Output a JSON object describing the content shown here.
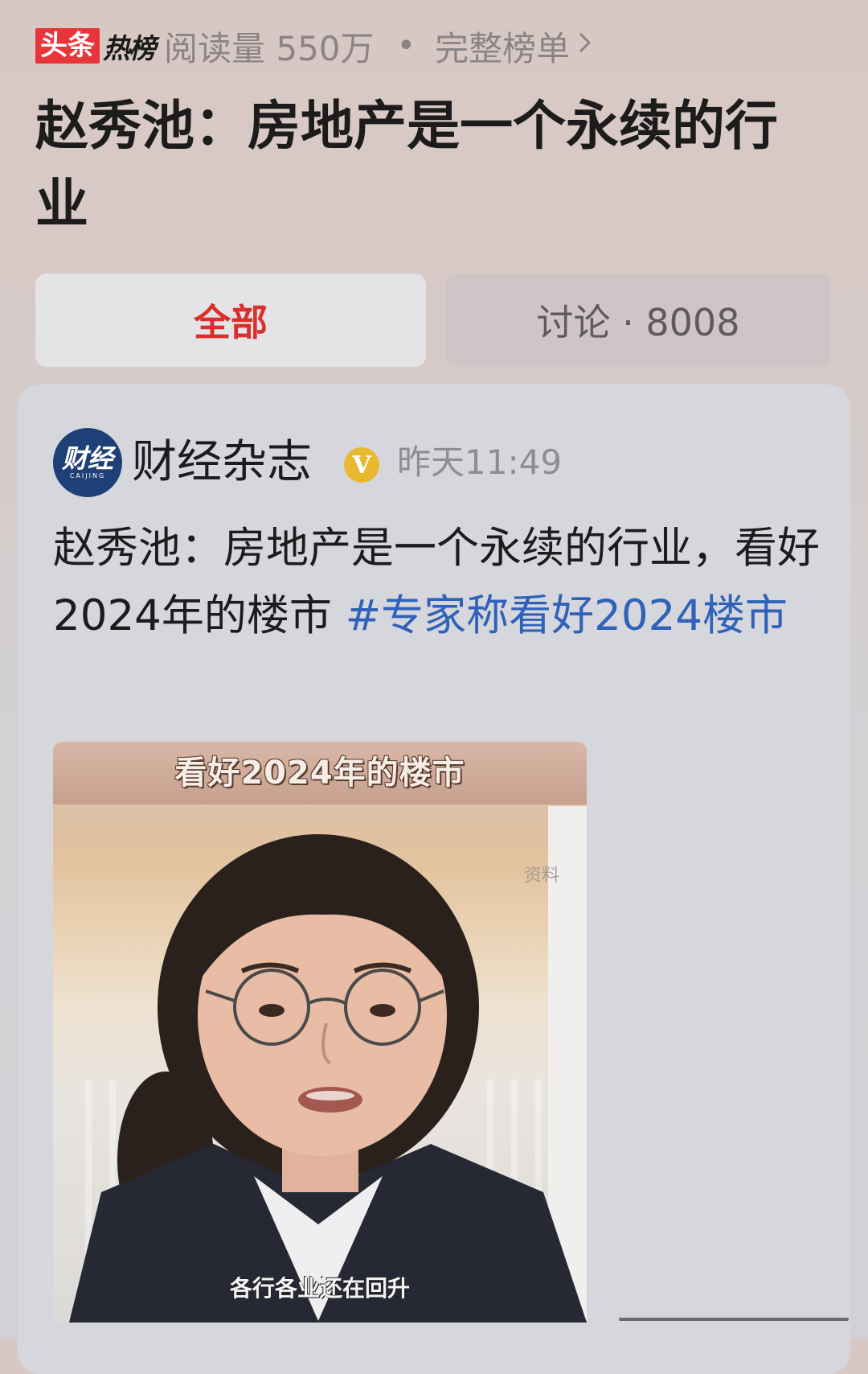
{
  "hot_bar": {
    "logo_toutiao": "头条",
    "logo_rebang": "热榜",
    "read_count": "阅读量 550万",
    "separator": "•",
    "full_list_label": "完整榜单",
    "chevron_icon": "chevron-right-icon"
  },
  "headline": "赵秀池：房地产是一个永续的行业",
  "tabs": [
    {
      "label": "全部",
      "active": true
    },
    {
      "label": "讨论 · 8008",
      "active": false
    }
  ],
  "post": {
    "author": "财经杂志",
    "avatar_text": "财经",
    "avatar_subtext": "CAIJING",
    "verified_badge": "V",
    "time": "昨天11:49",
    "text": "赵秀池：房地产是一个永续的行业，看好2024年的楼市",
    "hashtag": "#专家称看好2024楼市",
    "video": {
      "top_title": "看好2024年的楼市",
      "watermark": "资料",
      "subtitle": "各行各业还在回升"
    }
  },
  "colors": {
    "brand_red": "#e8353a",
    "active_tab": "#d9302d",
    "hashtag_blue": "#2f62b8",
    "verified_gold": "#e8b82e",
    "avatar_navy": "#1f3f77"
  }
}
